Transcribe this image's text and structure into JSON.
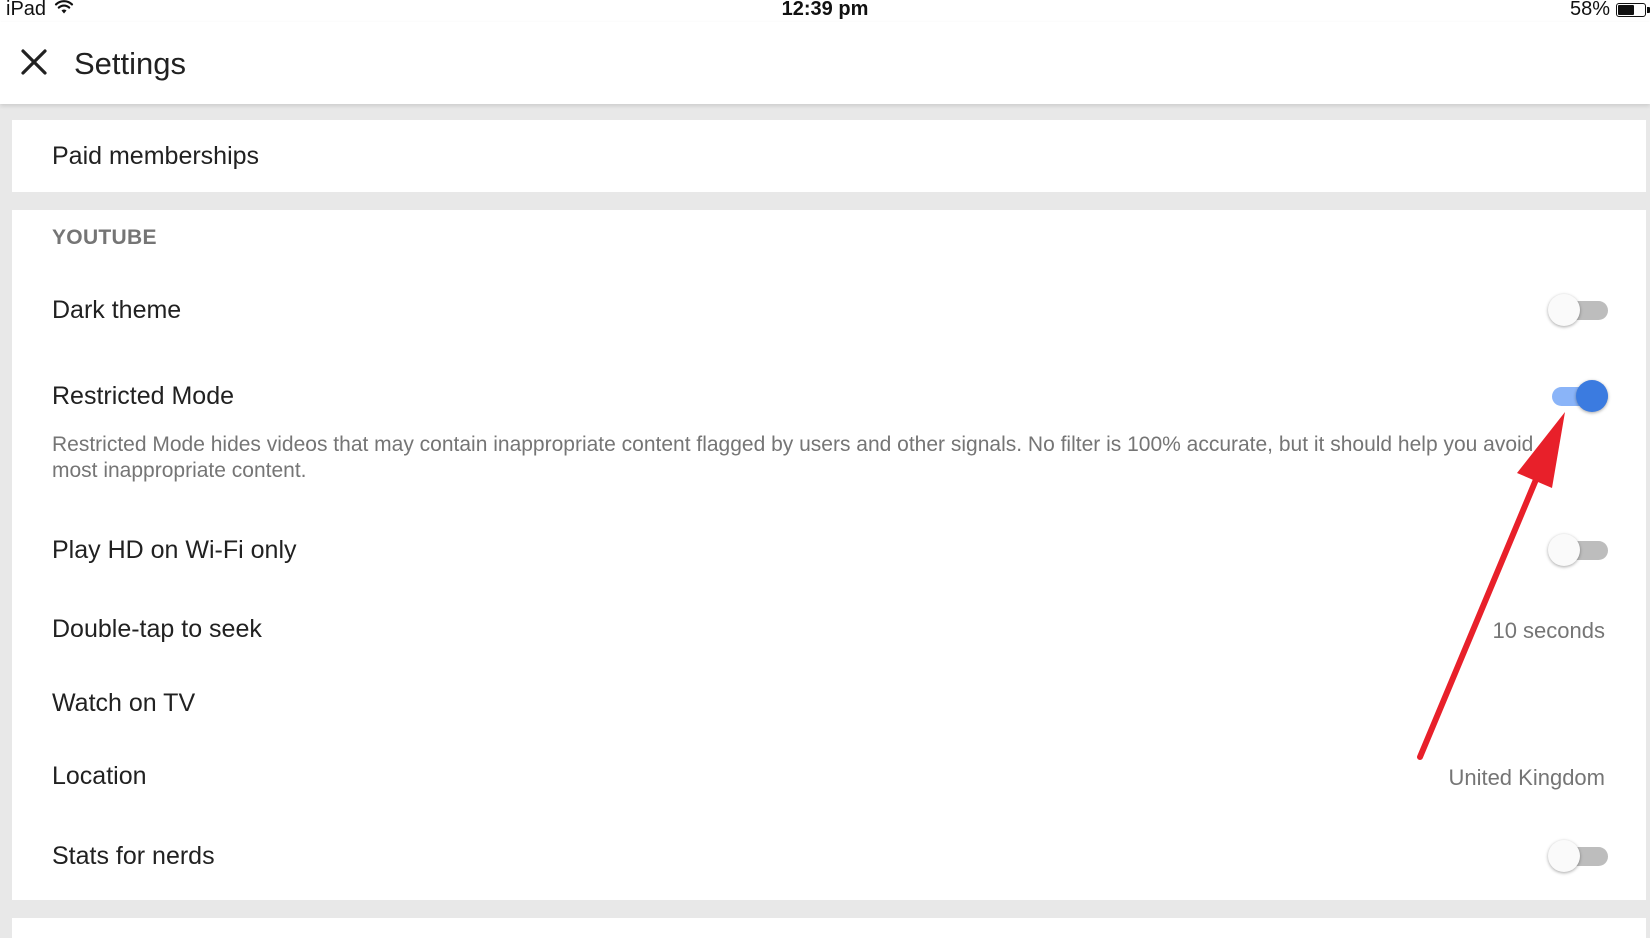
{
  "status_bar": {
    "device": "iPad",
    "time": "12:39 pm",
    "battery": "58%",
    "battery_level": 0.58
  },
  "header": {
    "title": "Settings",
    "close_icon": "close-icon"
  },
  "paid": {
    "label": "Paid memberships"
  },
  "youtube": {
    "section_title": "YOUTUBE",
    "dark_theme": {
      "label": "Dark theme",
      "enabled": false
    },
    "restricted_mode": {
      "label": "Restricted Mode",
      "enabled": true,
      "description": "Restricted Mode hides videos that may contain inappropriate content flagged by users and other signals. No filter is 100% accurate, but it should help you avoid most inappropriate content."
    },
    "play_hd": {
      "label": "Play HD on Wi-Fi only",
      "enabled": false
    },
    "double_tap": {
      "label": "Double-tap to seek",
      "value": "10 seconds"
    },
    "watch_tv": {
      "label": "Watch on TV"
    },
    "location": {
      "label": "Location",
      "value": "United Kingdom"
    },
    "stats": {
      "label": "Stats for nerds",
      "enabled": false
    }
  },
  "colors": {
    "accent": "#3b7be0",
    "accent_track": "#8ab4f8",
    "annotation_arrow": "#e8202a"
  }
}
